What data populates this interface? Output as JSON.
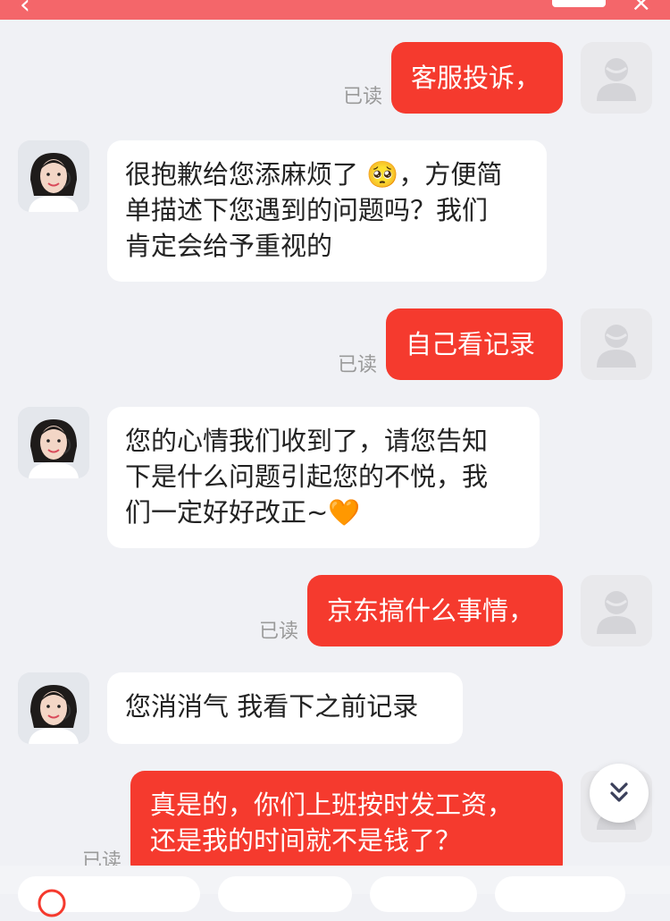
{
  "header": {
    "title": "",
    "back_icon": "back-chevron-icon",
    "close_icon": "close-icon"
  },
  "colors": {
    "user_bubble": "#f53a2e",
    "agent_bubble": "#ffffff",
    "background": "#f0f1f5",
    "banner": "#f4666a"
  },
  "messages": [
    {
      "from": "user",
      "text": "客服投诉，",
      "read": "已读"
    },
    {
      "from": "agent",
      "lines": [
        "很抱歉给您添麻烦了 🥺，方便简",
        "单描述下您遇到的问题吗？我们",
        "肯定会给予重视的"
      ]
    },
    {
      "from": "user",
      "text": "自己看记录",
      "read": "已读"
    },
    {
      "from": "agent",
      "lines": [
        "您的心情我们收到了，请您告知",
        "下是什么问题引起您的不悦，我",
        "们一定好好改正~🧡"
      ]
    },
    {
      "from": "user",
      "text": "京东搞什么事情，",
      "read": "已读"
    },
    {
      "from": "agent",
      "lines": [
        "您消消气 我看下之前记录"
      ]
    },
    {
      "from": "user",
      "lines": [
        "真是的，你们上班按时发工资，",
        "还是我的时间就不是钱了？"
      ],
      "read": "已读"
    }
  ],
  "scroll_button": {
    "icon": "double-chevron-down-icon"
  }
}
